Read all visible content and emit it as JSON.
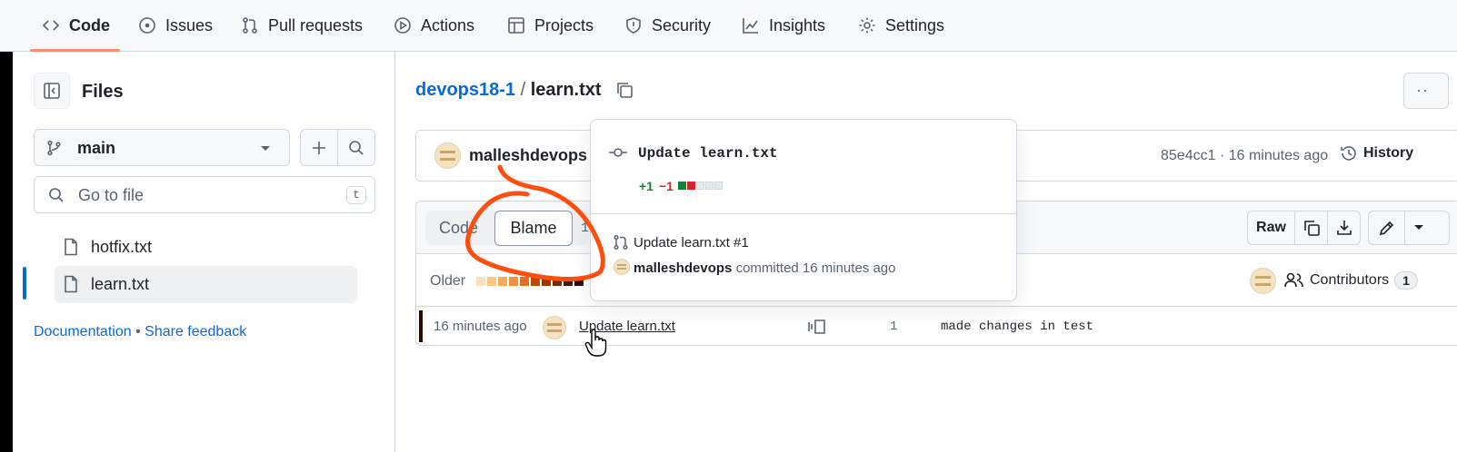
{
  "nav": {
    "code": "Code",
    "issues": "Issues",
    "pull_requests": "Pull requests",
    "actions": "Actions",
    "projects": "Projects",
    "security": "Security",
    "insights": "Insights",
    "settings": "Settings"
  },
  "sidebar": {
    "title": "Files",
    "branch": "main",
    "goto_placeholder": "Go to file",
    "goto_shortcut": "t",
    "files": [
      "hotfix.txt",
      "learn.txt"
    ],
    "documentation": "Documentation",
    "separator": "•",
    "share_feedback": "Share feedback"
  },
  "breadcrumb": {
    "repo": "devops18-1",
    "sep": "/",
    "file": "learn.txt"
  },
  "commit_bar": {
    "author": "malleshdevops",
    "sha_time": "85e4cc1 · 16 minutes ago",
    "history": "History"
  },
  "toolbar": {
    "code_tab": "Code",
    "blame_tab": "Blame",
    "lines": "1",
    "raw": "Raw"
  },
  "blame_header": {
    "older": "Older",
    "contributors": "Contributors",
    "contributors_count": "1"
  },
  "blame_row": {
    "time": "16 minutes ago",
    "commit_message": "Update learn.txt",
    "line_number": "1",
    "code": "made changes in test"
  },
  "popover": {
    "title": "Update learn.txt",
    "additions": "+1",
    "deletions": "−1",
    "pr": "Update learn.txt #1",
    "author": "malleshdevops",
    "committed": "committed 16 minutes ago"
  },
  "colors": {
    "link": "#0969da",
    "annotation": "#ff4d0c",
    "additions": "#1a7f37",
    "deletions": "#d1242f"
  }
}
